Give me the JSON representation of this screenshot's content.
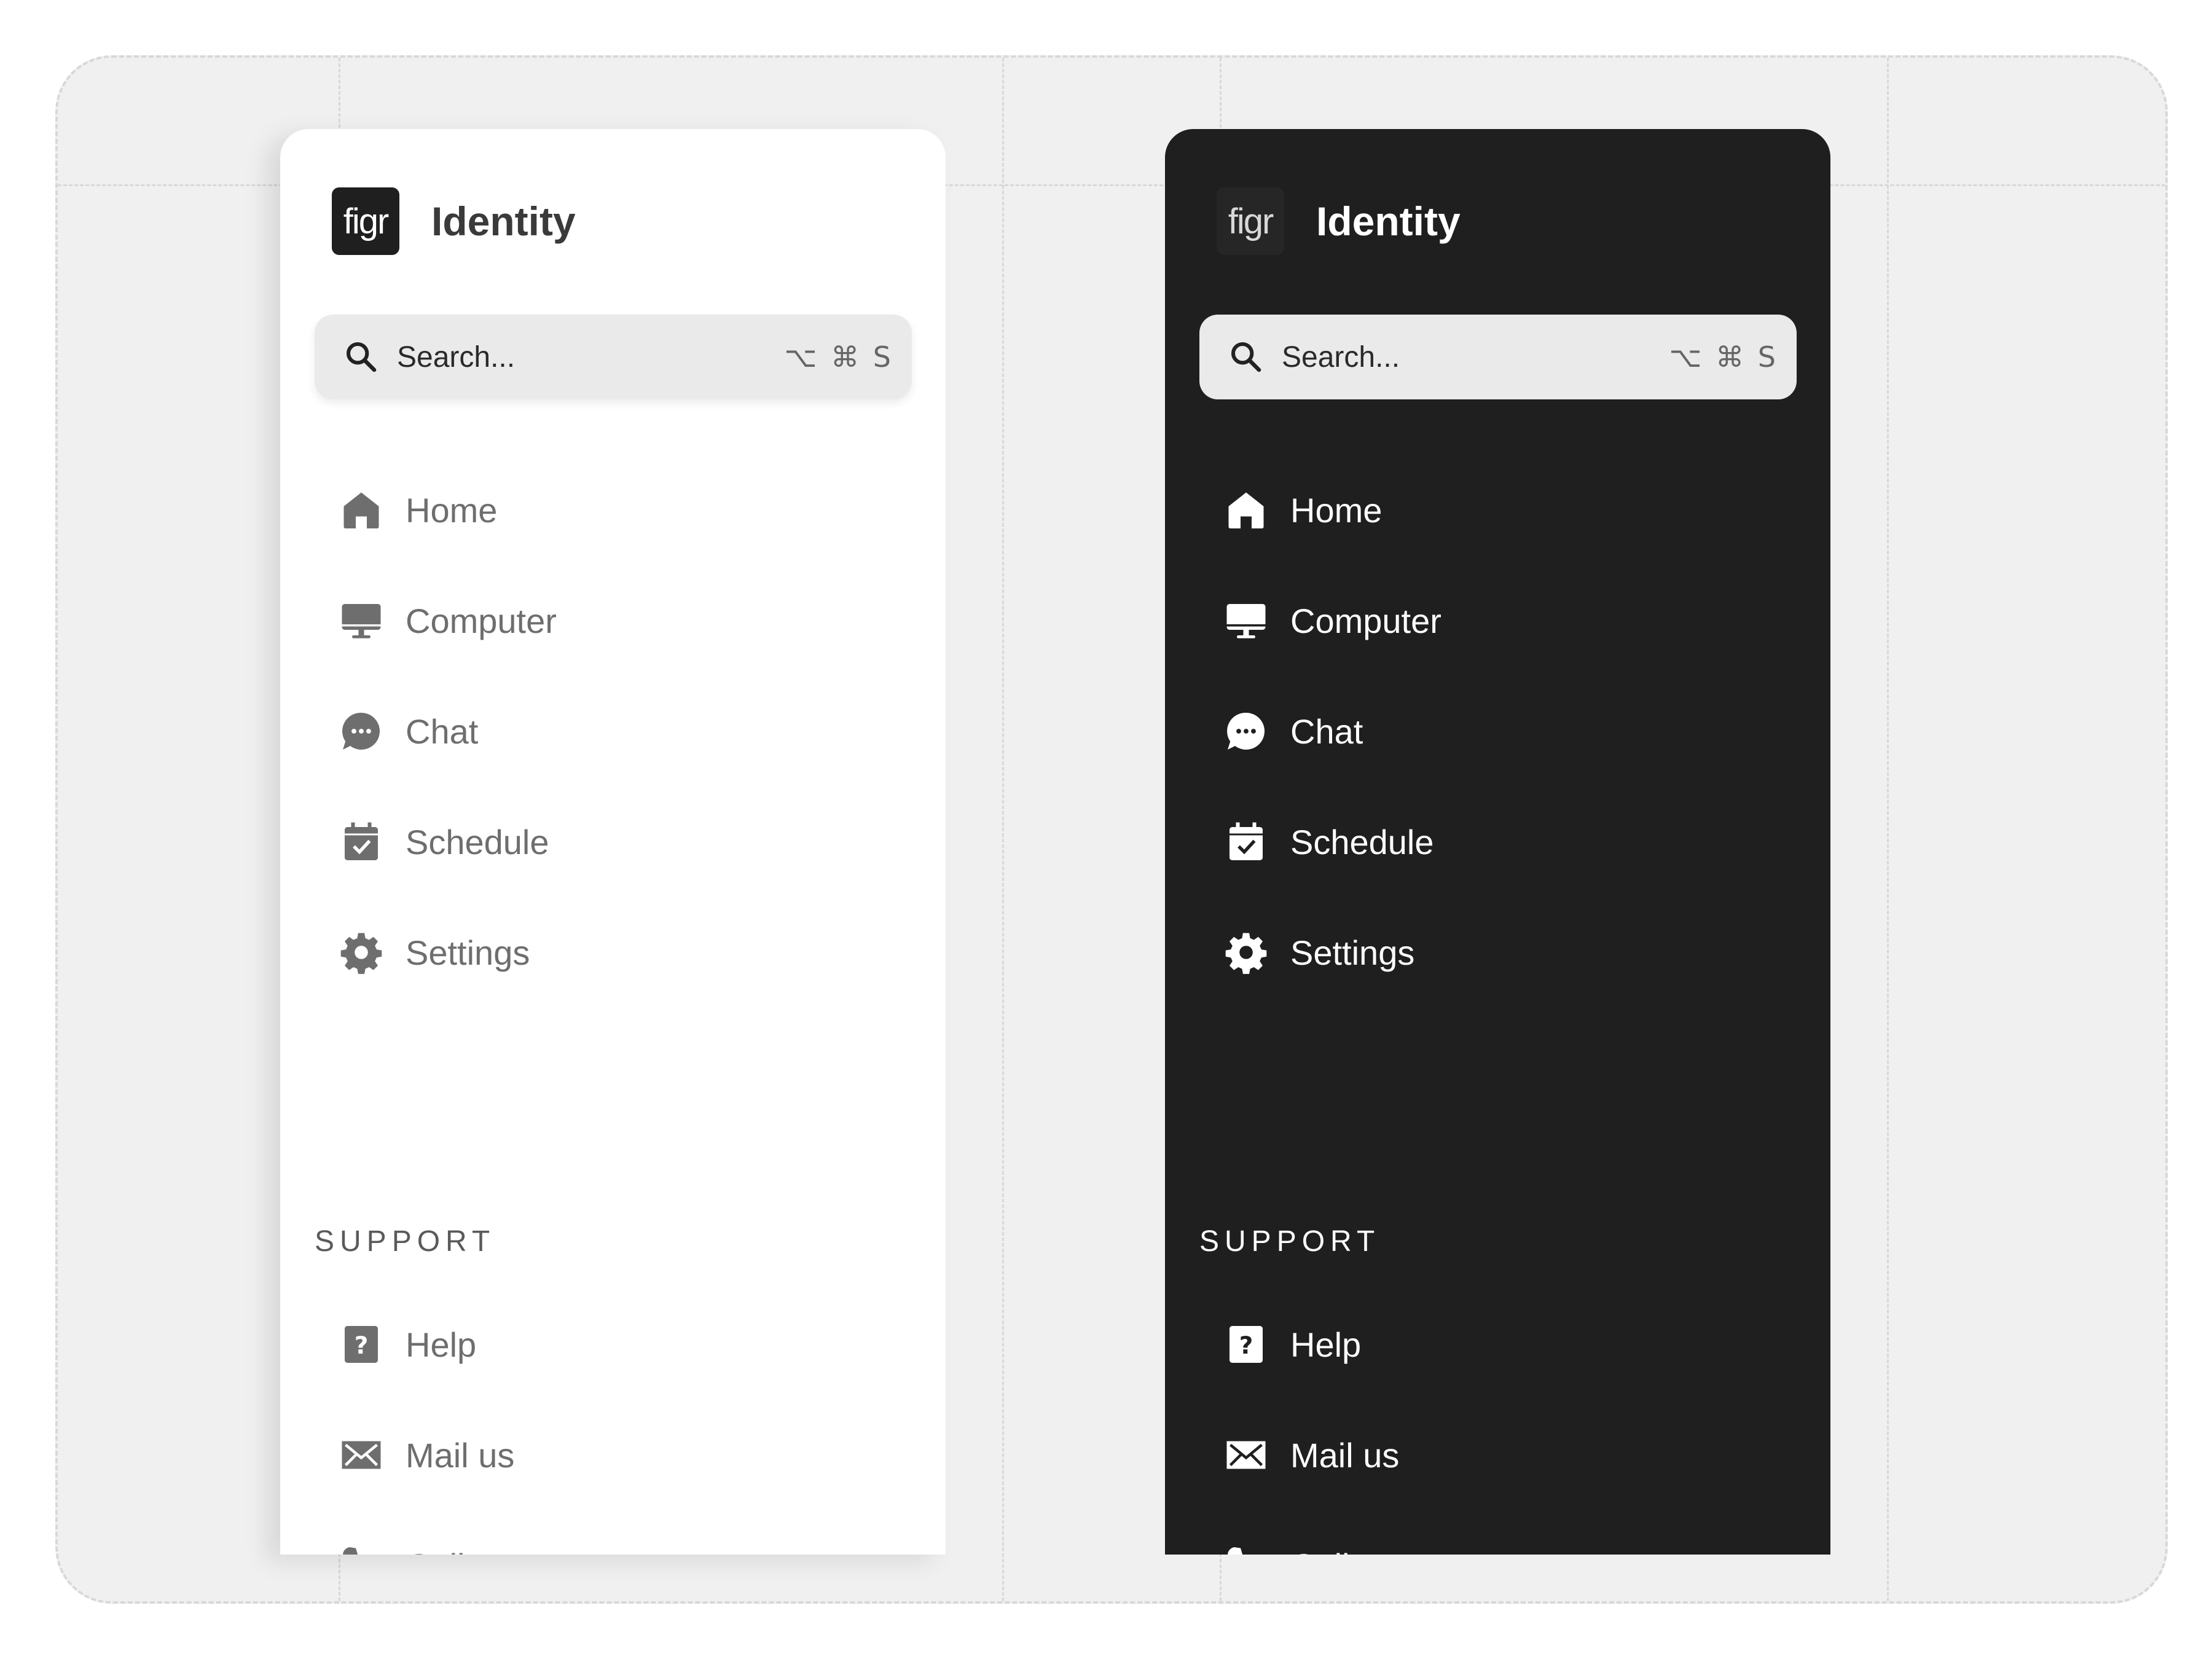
{
  "panels": {
    "light": {
      "logo_text": "figr",
      "title": "Identity",
      "search": {
        "placeholder": "Search...",
        "shortcut": "⌥ ⌘ S"
      },
      "nav": [
        {
          "label": "Home",
          "icon": "home-icon"
        },
        {
          "label": "Computer",
          "icon": "computer-icon"
        },
        {
          "label": "Chat",
          "icon": "chat-icon"
        },
        {
          "label": "Schedule",
          "icon": "calendar-check-icon"
        },
        {
          "label": "Settings",
          "icon": "gear-icon"
        }
      ],
      "support_heading": "SUPPORT",
      "support": [
        {
          "label": "Help",
          "icon": "help-icon"
        },
        {
          "label": "Mail us",
          "icon": "mail-icon"
        },
        {
          "label": "Call us",
          "icon": "phone-icon"
        }
      ]
    },
    "dark": {
      "logo_text": "figr",
      "title": "Identity",
      "search": {
        "placeholder": "Search...",
        "shortcut": "⌥ ⌘ S"
      },
      "nav": [
        {
          "label": "Home",
          "icon": "home-icon"
        },
        {
          "label": "Computer",
          "icon": "computer-icon"
        },
        {
          "label": "Chat",
          "icon": "chat-icon"
        },
        {
          "label": "Schedule",
          "icon": "calendar-check-icon"
        },
        {
          "label": "Settings",
          "icon": "gear-icon"
        }
      ],
      "support_heading": "SUPPORT",
      "support": [
        {
          "label": "Help",
          "icon": "help-icon"
        },
        {
          "label": "Mail us",
          "icon": "mail-icon"
        },
        {
          "label": "Call us",
          "icon": "phone-icon"
        }
      ]
    }
  },
  "colors": {
    "light_panel": "#ffffff",
    "dark_panel": "#1f1f1f",
    "canvas": "#f0f0f0",
    "search_bg": "#eaeaea",
    "light_text": "#6e6e6e",
    "dark_text": "#ffffff"
  }
}
